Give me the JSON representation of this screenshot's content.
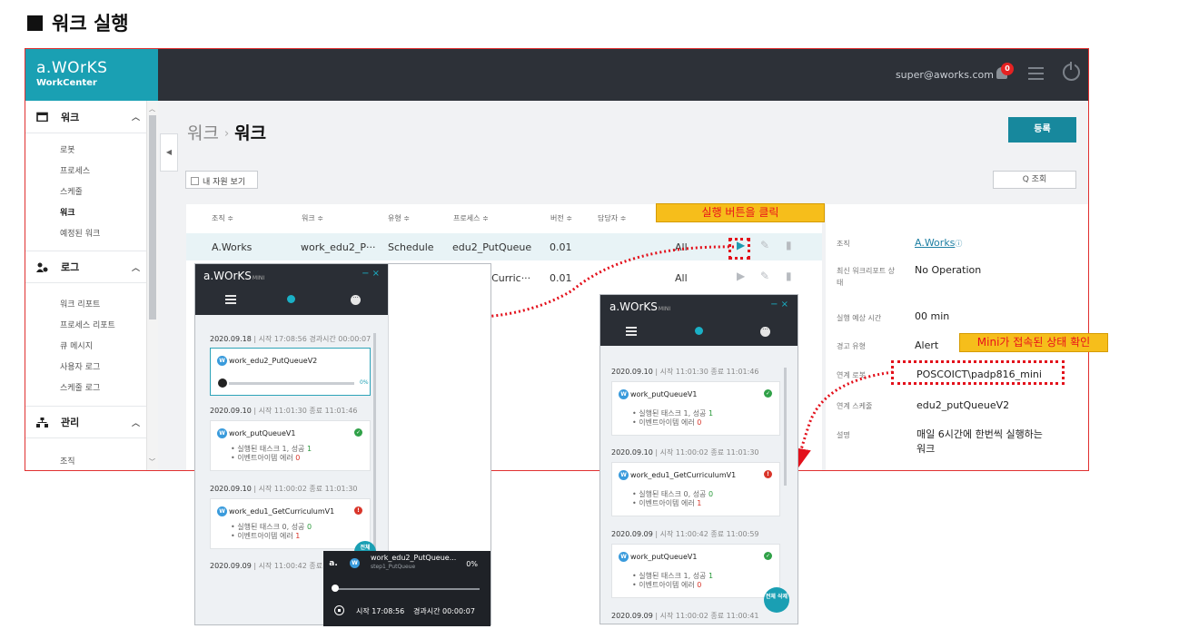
{
  "heading": "워크 실행",
  "app": {
    "logo": {
      "brand": "a.WOrKS",
      "sub": "WorkCenter"
    },
    "user": "super@aworks.com",
    "notifications": "0"
  },
  "sidebar": {
    "groups": [
      {
        "label": "워크",
        "icon": "calendar-icon"
      },
      {
        "label": "로그",
        "icon": "users-icon"
      },
      {
        "label": "관리",
        "icon": "org-icon"
      }
    ],
    "work_items": [
      "로봇",
      "프로세스",
      "스케줄",
      "워크",
      "예정된 워크"
    ],
    "log_items": [
      "워크 리포트",
      "프로세스 리포트",
      "큐 메시지",
      "사용자 로그",
      "스케줄 로그"
    ],
    "admin_items": [
      "조직"
    ]
  },
  "main": {
    "breadcrumb": {
      "parent": "워크",
      "sep": "›",
      "current": "워크"
    },
    "register": "등록",
    "my_resources": "내 자원 보기",
    "search": "Q  조회"
  },
  "table": {
    "headers": [
      "조직 ≑",
      "워크 ≑",
      "유형 ≑",
      "프로세스 ≑",
      "버전 ≑",
      "담당자 ≑"
    ],
    "rows": [
      {
        "org": "A.Works",
        "work": "work_edu2_P···",
        "type": "Schedule",
        "process": "edu2_PutQueue",
        "version": "0.01",
        "owner": "All"
      },
      {
        "org": "",
        "work": "",
        "type": "",
        "process": "etCurric···",
        "version": "0.01",
        "owner": "All"
      }
    ]
  },
  "detail": {
    "labels": [
      "조직",
      "최신 워크리포트 상태",
      "실행 예상 시간",
      "경고 유형",
      "연계 로봇",
      "연계 스케줄",
      "설명"
    ],
    "org": "A.Works",
    "org_info": "ⓘ",
    "latest_report": "No Operation",
    "expected_time": "00 min",
    "alert_type": "Alert",
    "robot": "POSCOICT\\padp816_mini",
    "schedule": "edu2_putQueueV2",
    "description": "매일 6시간에 한번씩 실행하는 워크"
  },
  "callouts": {
    "click_run": "실행 버튼을 클릭",
    "mini_connected": "Mini가 접속된 상태 확인"
  },
  "mini_left": {
    "brand": "a.WOrKS",
    "brand_small": "MINI",
    "controls": "− ×",
    "entries": [
      {
        "date": "2020.09.18",
        "meta": " | 시작 17:08:56  경과시간 00:00:07",
        "name": "work_edu2_PutQueueV2",
        "progress": "0%"
      },
      {
        "date": "2020.09.10",
        "meta": " | 시작 11:01:30  종료 11:01:46",
        "name": "work_putQueueV1",
        "tasks": "• 실행된 태스크 ",
        "t1": "1",
        "succ_label": ", 성공 ",
        "s1": "1",
        "err_label": "• 이벤트아이템 에러 ",
        "e1": "0"
      },
      {
        "date": "2020.09.10",
        "meta": " | 시작 11:00:02  종료 11:01:30",
        "name": "work_edu1_GetCurriculumV1",
        "tasks": "• 실행된 태스크 ",
        "t1": "0",
        "succ_label": ", 성공 ",
        "s1": "0",
        "err_label": "• 이벤트아이템 에러 ",
        "e1": "1"
      },
      {
        "date": "2020.09.09",
        "meta": " | 시작 11:00:42  종료 11:"
      }
    ],
    "fab": "전체"
  },
  "mini_right": {
    "brand": "a.WOrKS",
    "brand_small": "MINI",
    "controls": "− ×",
    "entries": [
      {
        "date": "2020.09.10",
        "meta": " | 시작 11:01:30  종료 11:01:46",
        "name": "work_putQueueV1",
        "tasks": "• 실행된 태스크 ",
        "t1": "1",
        "succ_label": ", 성공 ",
        "s1": "1",
        "err_label": "• 이벤트아이템 에러 ",
        "e1": "0"
      },
      {
        "date": "2020.09.10",
        "meta": " | 시작 11:00:02  종료 11:01:30",
        "name": "work_edu1_GetCurriculumV1",
        "tasks": "• 실행된 태스크 ",
        "t1": "0",
        "succ_label": ", 성공 ",
        "s1": "0",
        "err_label": "• 이벤트아이템 에러 ",
        "e1": "1"
      },
      {
        "date": "2020.09.09",
        "meta": " | 시작 11:00:42  종료 11:00:59",
        "name": "work_putQueueV1",
        "tasks": "• 실행된 태스크 ",
        "t1": "1",
        "succ_label": ", 성공 ",
        "s1": "1",
        "err_label": "• 이벤트아이템 에러 ",
        "e1": "0"
      },
      {
        "date": "2020.09.09",
        "meta": " | 시작 11:00:02  종료 11:00:41"
      }
    ],
    "fab": "전체 삭제"
  },
  "toast": {
    "app_short": "a.",
    "title": "work_edu2_PutQueue...",
    "step": "step1_PutQueue",
    "percent": "0%",
    "progress": 0,
    "start": "시작  17:08:56",
    "elapsed": "경과시간  00:00:07"
  },
  "colors": {
    "accent": "#17889d",
    "topbar": "#2d3138",
    "callout": "#f6be1b",
    "callout_text": "#e8101b"
  }
}
